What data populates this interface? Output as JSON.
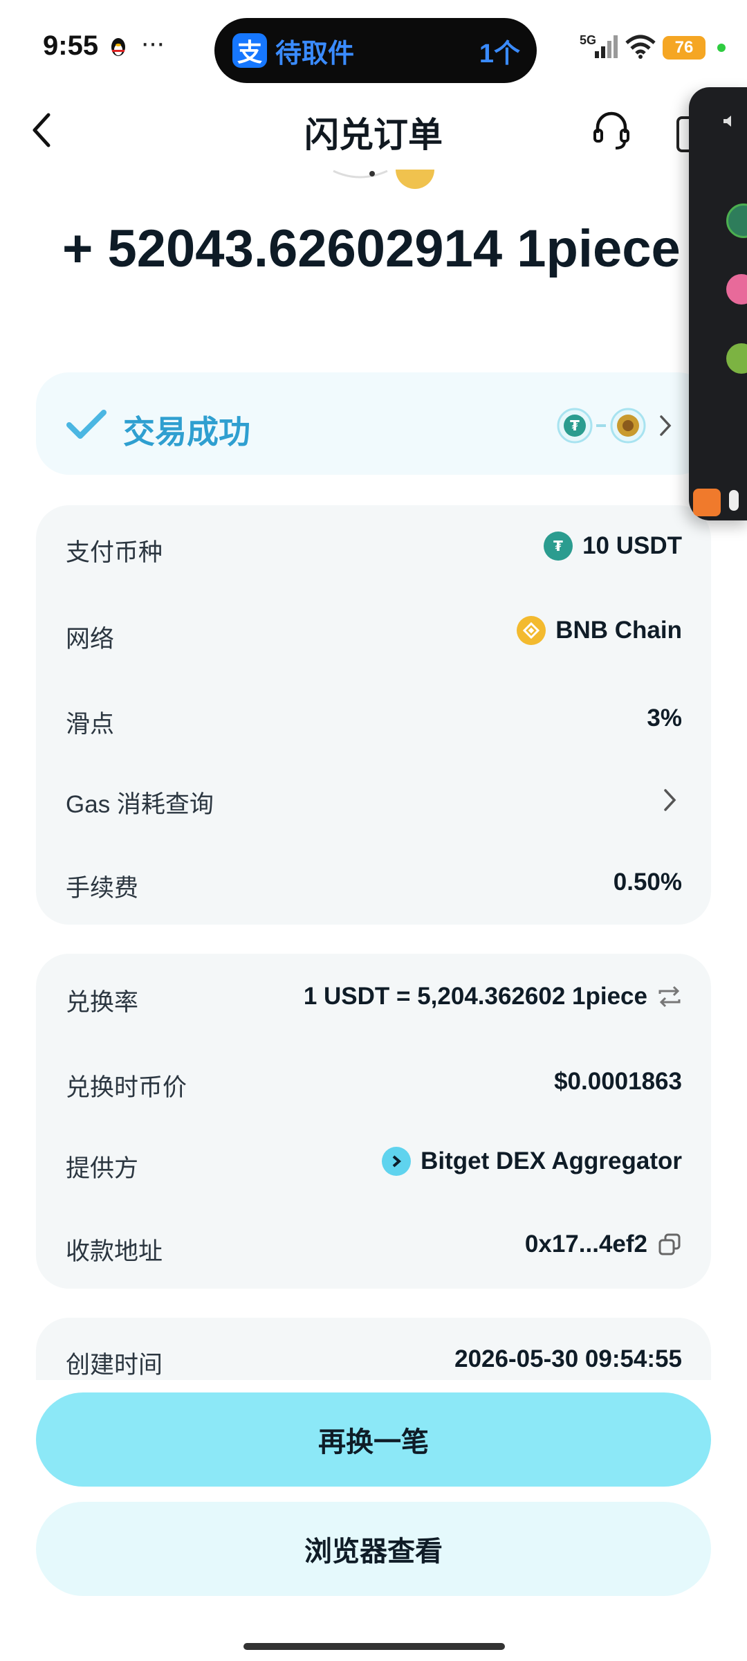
{
  "status_bar": {
    "time": "9:55",
    "more": "···",
    "notification": {
      "app_icon": "支",
      "text": "待取件",
      "count": "1个"
    },
    "network": "5G",
    "battery": "76"
  },
  "header": {
    "title": "闪兑订单"
  },
  "amount": "+ 52043.62602914 1piece",
  "status": {
    "text": "交易成功"
  },
  "details1": {
    "pay_token_label": "支付币种",
    "pay_token_value": "10 USDT",
    "network_label": "网络",
    "network_value": "BNB Chain",
    "slippage_label": "滑点",
    "slippage_value": "3%",
    "gas_label": "Gas 消耗查询",
    "fee_label": "手续费",
    "fee_value": "0.50%"
  },
  "details2": {
    "rate_label": "兑换率",
    "rate_value": "1 USDT = 5,204.362602 1piece",
    "price_label": "兑换时币价",
    "price_value": "$0.0001863",
    "provider_label": "提供方",
    "provider_value": "Bitget DEX Aggregator",
    "address_label": "收款地址",
    "address_value": "0x17...4ef2"
  },
  "details3": {
    "created_label": "创建时间",
    "created_value": "2026-05-30 09:54:55"
  },
  "actions": {
    "swap_again": "再换一笔",
    "view_in_browser": "浏览器查看"
  },
  "colors": {
    "accent": "#2f9fd0",
    "primary_button": "#8ce8f7",
    "secondary_button": "#e5f9fc",
    "card_bg": "#f4f7f8"
  }
}
